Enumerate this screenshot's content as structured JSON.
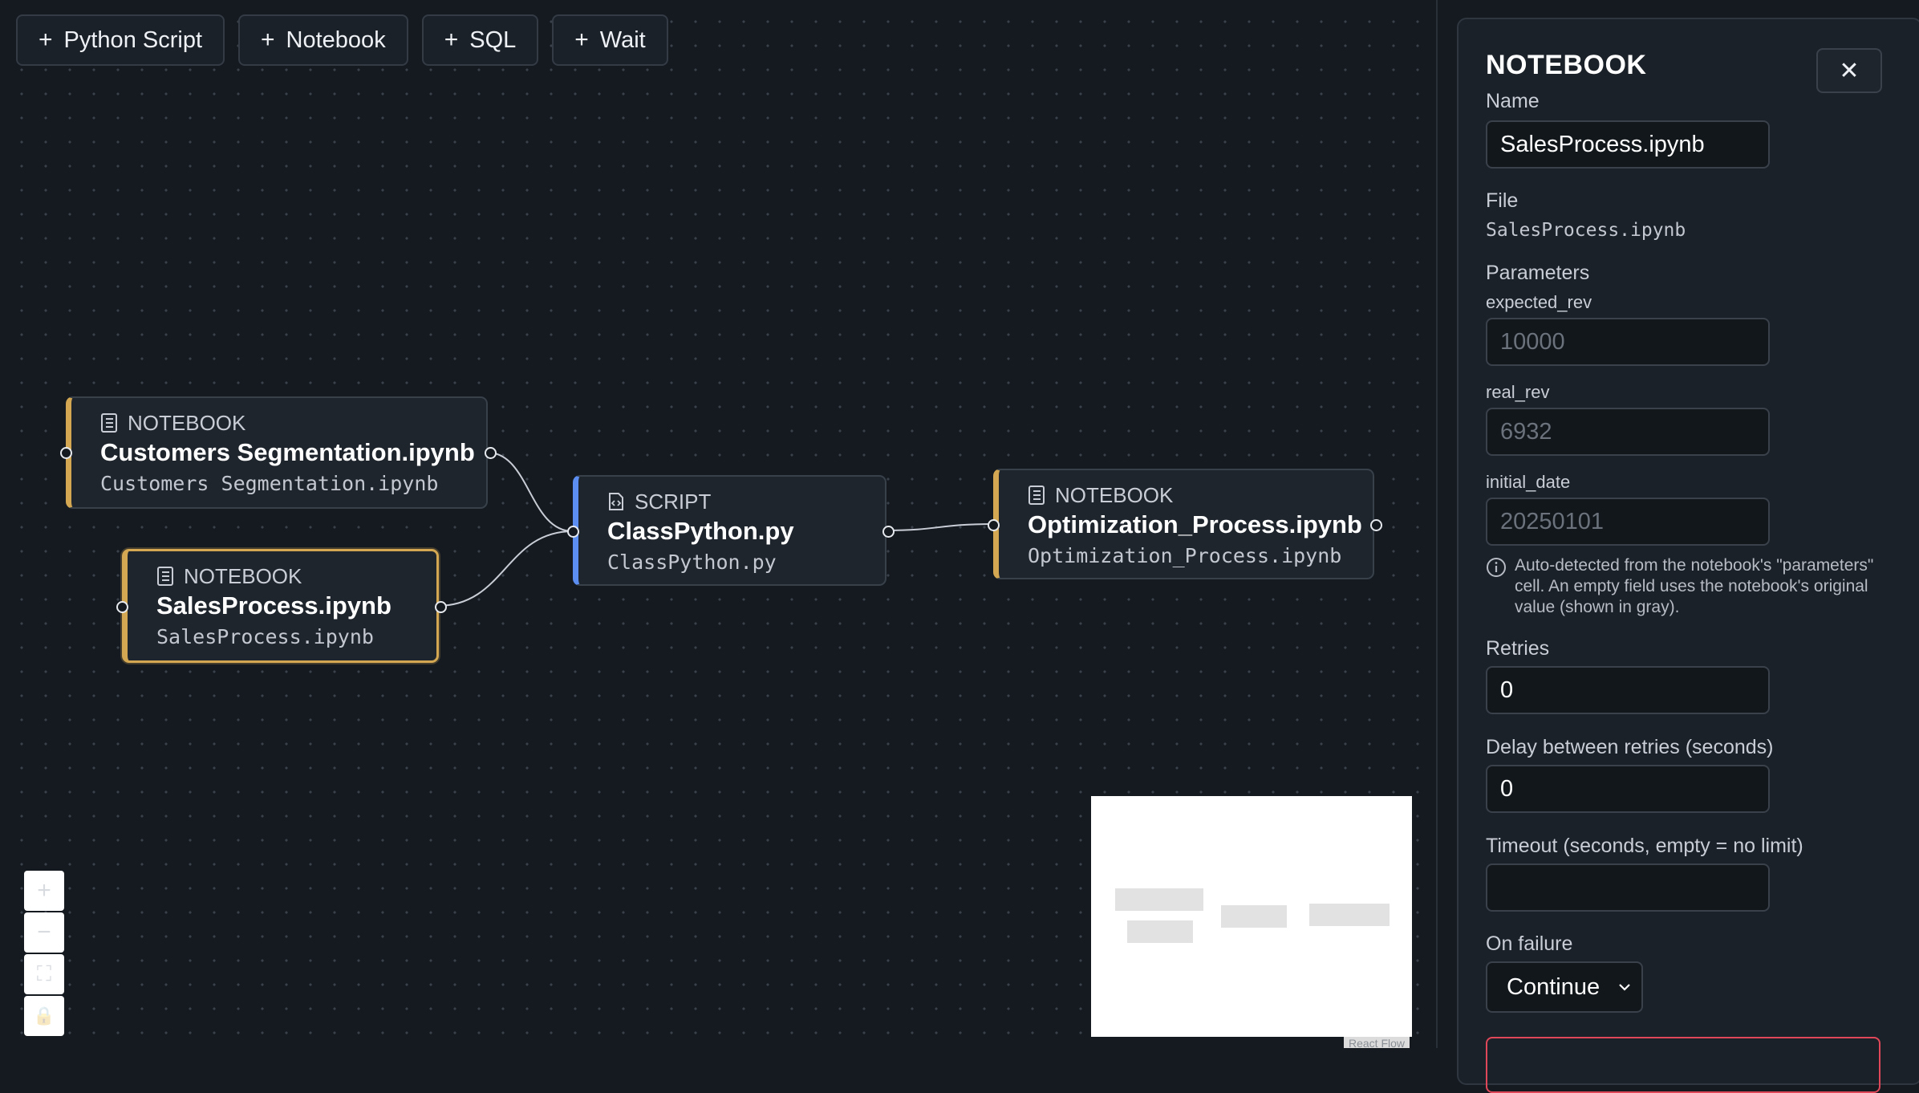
{
  "toolbar": {
    "buttons": [
      {
        "label": "Python Script"
      },
      {
        "label": "Notebook"
      },
      {
        "label": "SQL"
      },
      {
        "label": "Wait"
      }
    ]
  },
  "nodes": {
    "customers": {
      "type": "NOTEBOOK",
      "title": "Customers Segmentation.ipynb",
      "file": "Customers Segmentation.ipynb"
    },
    "sales": {
      "type": "NOTEBOOK",
      "title": "SalesProcess.ipynb",
      "file": "SalesProcess.ipynb"
    },
    "classpython": {
      "type": "SCRIPT",
      "title": "ClassPython.py",
      "file": "ClassPython.py"
    },
    "optimization": {
      "type": "NOTEBOOK",
      "title": "Optimization_Process.ipynb",
      "file": "Optimization_Process.ipynb"
    }
  },
  "canvas_controls": {
    "zoom_in": "+",
    "zoom_out": "−",
    "fit_view": "⛶",
    "lock": "🔒"
  },
  "attribution": "React Flow",
  "panel": {
    "title": "NOTEBOOK",
    "close_label": "✕",
    "name_label": "Name",
    "name_value": "SalesProcess.ipynb",
    "file_label": "File",
    "file_value": "SalesProcess.ipynb",
    "parameters_label": "Parameters",
    "params": [
      {
        "name": "expected_rev",
        "placeholder": "10000"
      },
      {
        "name": "real_rev",
        "placeholder": "6932"
      },
      {
        "name": "initial_date",
        "placeholder": "20250101"
      }
    ],
    "hint": "Auto-detected from the notebook's \"parameters\" cell. An empty field uses the notebook's original value (shown in gray).",
    "retries_label": "Retries",
    "retries_value": "0",
    "delay_label": "Delay between retries (seconds)",
    "delay_value": "0",
    "timeout_label": "Timeout (seconds, empty = no limit)",
    "timeout_value": "",
    "on_failure_label": "On failure",
    "on_failure_value": "Continue"
  },
  "colors": {
    "notebook_accent": "#d4a853",
    "script_accent": "#5b8ef0",
    "danger": "#e0485a",
    "canvas_bg": "#141a20"
  }
}
